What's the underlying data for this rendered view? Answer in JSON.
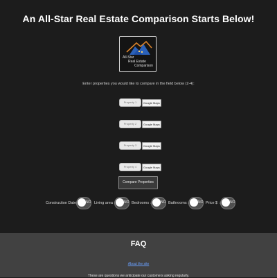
{
  "header": {
    "title": "An All-Star Real Estate Comparison Starts Below!"
  },
  "logo": {
    "line1": "All-Star",
    "line2": "Real Estate",
    "line3": "Comparison"
  },
  "instructions": "Enter properties you would like to compare in the field below (2-4):",
  "properties": [
    {
      "placeholder": "Property 1",
      "maps_label": "Google Maps"
    },
    {
      "placeholder": "Property 2",
      "maps_label": "Google Maps"
    },
    {
      "placeholder": "Property 3",
      "maps_label": "Google Maps"
    },
    {
      "placeholder": "Property 4",
      "maps_label": "Google Maps"
    }
  ],
  "compare_button": "Compare Properties",
  "filters": [
    {
      "label": "Construction Date :",
      "state": "NO"
    },
    {
      "label": "Living area :",
      "state": "NO"
    },
    {
      "label": "Bedrooms :",
      "state": "NO"
    },
    {
      "label": "Bathrooms :",
      "state": "NO"
    },
    {
      "label": "Price $ :",
      "state": "NO"
    }
  ],
  "faq": {
    "title": "FAQ",
    "link": "About the site",
    "description": "These are questions we anticipate our customers asking regularly."
  },
  "colors": {
    "background": "#1c1c1c",
    "faq_background": "#414141",
    "link": "#6aa0ff",
    "logo_house_blue": "#2f6fd6",
    "logo_roof_orange": "#d9822b"
  }
}
